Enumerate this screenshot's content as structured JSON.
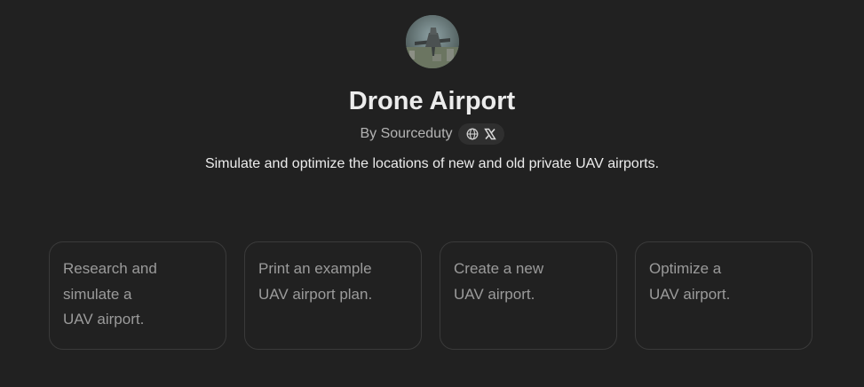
{
  "gpt": {
    "title": "Drone Airport",
    "byline": "By Sourceduty",
    "description": "Simulate and optimize the locations of new and old private UAV airports.",
    "social_icons": [
      "globe-icon",
      "x-logo-icon"
    ]
  },
  "conversation_starters": [
    {
      "text": "Research and\nsimulate a\nUAV airport."
    },
    {
      "text": "Print an example\nUAV airport plan."
    },
    {
      "text": "Create a new\nUAV airport."
    },
    {
      "text": "Optimize a\nUAV airport."
    }
  ],
  "colors": {
    "background": "#212121",
    "card_border": "#3a3a3a",
    "title_text": "#ececec",
    "muted_text": "#b4b4b4",
    "starter_text": "#9b9b9b"
  }
}
